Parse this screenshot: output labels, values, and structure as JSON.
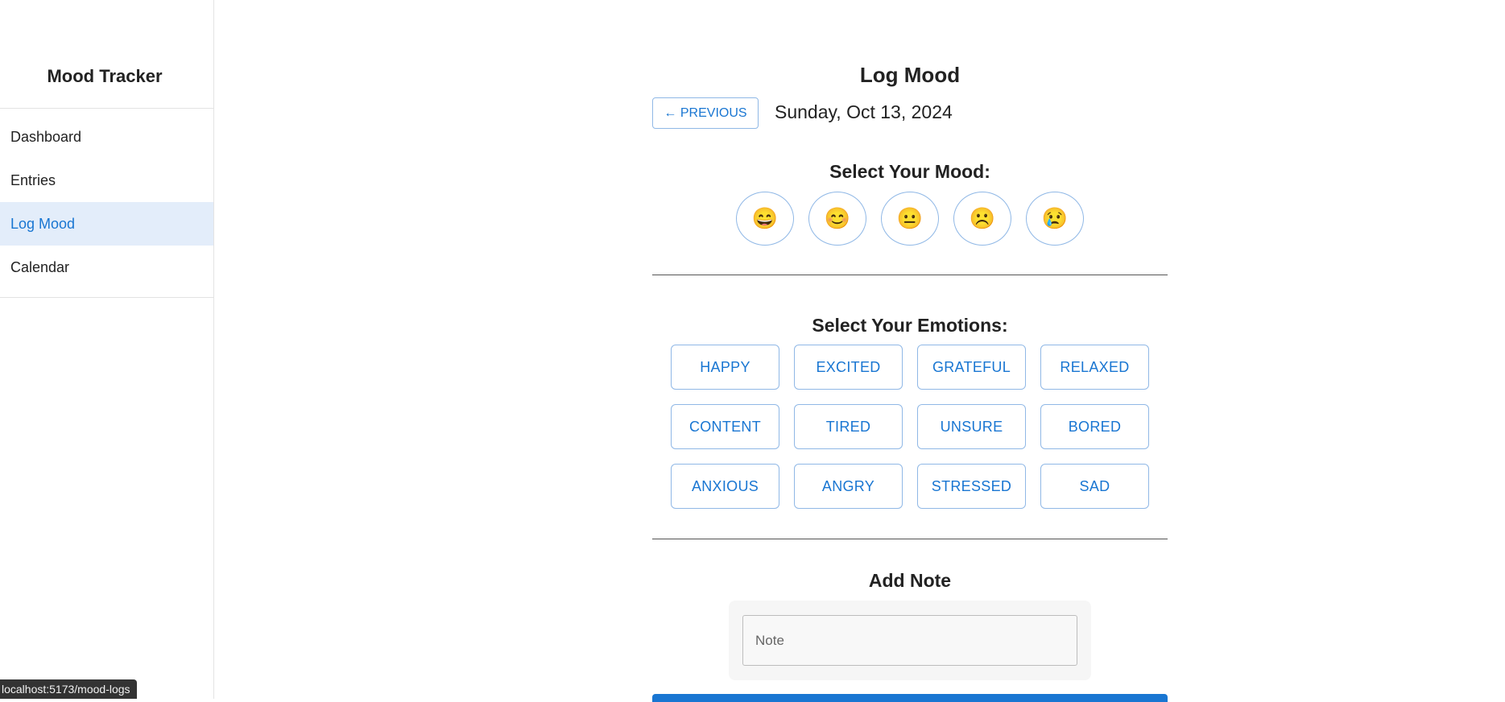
{
  "sidebar": {
    "title": "Mood Tracker",
    "items": [
      {
        "label": "Dashboard"
      },
      {
        "label": "Entries"
      },
      {
        "label": "Log Mood"
      },
      {
        "label": "Calendar"
      }
    ]
  },
  "main": {
    "title": "Log Mood",
    "prev_label": "← PREVIOUS",
    "date": "Sunday, Oct 13, 2024",
    "mood_title": "Select Your Mood:",
    "moods": [
      {
        "emoji": "😄"
      },
      {
        "emoji": "😊"
      },
      {
        "emoji": "😐"
      },
      {
        "emoji": "☹️"
      },
      {
        "emoji": "😢"
      }
    ],
    "emotions_title": "Select Your Emotions:",
    "emotions": [
      "HAPPY",
      "EXCITED",
      "GRATEFUL",
      "RELAXED",
      "CONTENT",
      "TIRED",
      "UNSURE",
      "BORED",
      "ANXIOUS",
      "ANGRY",
      "STRESSED",
      "SAD"
    ],
    "note_title": "Add Note",
    "note_placeholder": "Note"
  },
  "status_url": "localhost:5173/mood-logs",
  "colors": {
    "accent": "#1976d2",
    "active_bg": "#e3edfa",
    "border": "#90b8e6"
  }
}
